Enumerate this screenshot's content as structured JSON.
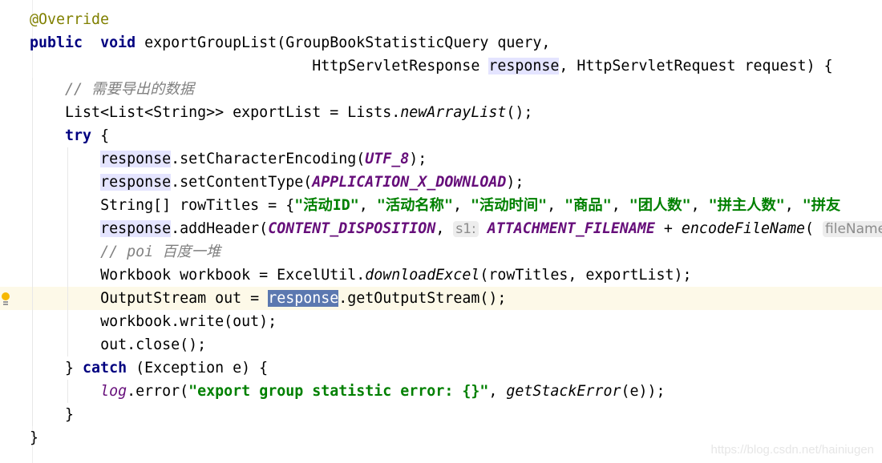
{
  "colors": {
    "keyword": "#000080",
    "annotation": "#808000",
    "comment": "#808080",
    "string": "#008000",
    "constant": "#660e7a",
    "selection": "#5b78b0",
    "reference_highlight": "#e4e4ff",
    "caret_line": "#fdf9e8"
  },
  "caret_line_index": 12,
  "gutter_icon": "intention-bulb-icon",
  "lines": [
    {
      "indent": 0,
      "tokens": [
        [
          "ann",
          "@Override"
        ]
      ]
    },
    {
      "indent": 0,
      "tokens": [
        [
          "kw",
          "public"
        ],
        [
          "",
          "  "
        ],
        [
          "kw",
          "void"
        ],
        [
          "",
          " exportGroupList(GroupBookStatisticQuery query,"
        ]
      ]
    },
    {
      "indent": 0,
      "tokens": [
        [
          "",
          "                                "
        ],
        [
          "",
          "HttpServletResponse "
        ],
        [
          "ref",
          "response"
        ],
        [
          "",
          ", HttpServletRequest request) {"
        ]
      ]
    },
    {
      "indent": 1,
      "tokens": [
        [
          "cm",
          "// 需要导出的数据"
        ]
      ]
    },
    {
      "indent": 1,
      "tokens": [
        [
          "",
          "List<List<String>> exportList = Lists."
        ],
        [
          "it",
          "newArrayList"
        ],
        [
          "",
          "();"
        ]
      ]
    },
    {
      "indent": 1,
      "tokens": [
        [
          "kw",
          "try"
        ],
        [
          "",
          " {"
        ]
      ]
    },
    {
      "indent": 2,
      "tokens": [
        [
          "ref",
          "response"
        ],
        [
          "",
          ".setCharacterEncoding("
        ],
        [
          "const",
          "UTF_8"
        ],
        [
          "",
          ");"
        ]
      ]
    },
    {
      "indent": 2,
      "tokens": [
        [
          "ref",
          "response"
        ],
        [
          "",
          ".setContentType("
        ],
        [
          "const",
          "APPLICATION_X_DOWNLOAD"
        ],
        [
          "",
          ");"
        ]
      ]
    },
    {
      "indent": 2,
      "tokens": [
        [
          "",
          "String[] rowTitles = {"
        ],
        [
          "str",
          "\"活动ID\""
        ],
        [
          "",
          ", "
        ],
        [
          "str",
          "\"活动名称\""
        ],
        [
          "",
          ", "
        ],
        [
          "str",
          "\"活动时间\""
        ],
        [
          "",
          ", "
        ],
        [
          "str",
          "\"商品\""
        ],
        [
          "",
          ", "
        ],
        [
          "str",
          "\"团人数\""
        ],
        [
          "",
          ", "
        ],
        [
          "str",
          "\"拼主人数\""
        ],
        [
          "",
          ", "
        ],
        [
          "str",
          "\"拼友"
        ]
      ]
    },
    {
      "indent": 2,
      "tokens": [
        [
          "ref",
          "response"
        ],
        [
          "",
          ".addHeader("
        ],
        [
          "const",
          "CONTENT_DISPOSITION"
        ],
        [
          "",
          ", "
        ],
        [
          "hint",
          "s1:"
        ],
        [
          "",
          " "
        ],
        [
          "const",
          "ATTACHMENT_FILENAME"
        ],
        [
          "",
          " + "
        ],
        [
          "it",
          "encodeFileName"
        ],
        [
          "",
          "( "
        ],
        [
          "hint",
          "fileName"
        ]
      ]
    },
    {
      "indent": 2,
      "tokens": [
        [
          "cm",
          "// poi 百度一堆"
        ]
      ]
    },
    {
      "indent": 2,
      "tokens": [
        [
          "",
          "Workbook workbook = ExcelUtil."
        ],
        [
          "it",
          "downloadExcel"
        ],
        [
          "",
          "(rowTitles, exportList);"
        ]
      ]
    },
    {
      "indent": 2,
      "tokens": [
        [
          "",
          "OutputStream out = "
        ],
        [
          "sel",
          "response"
        ],
        [
          "",
          ".getOutputStream();"
        ]
      ]
    },
    {
      "indent": 2,
      "tokens": [
        [
          "",
          "workbook.write(out);"
        ]
      ]
    },
    {
      "indent": 2,
      "tokens": [
        [
          "",
          "out.close();"
        ]
      ]
    },
    {
      "indent": 1,
      "tokens": [
        [
          "",
          "} "
        ],
        [
          "kw",
          "catch"
        ],
        [
          "",
          " (Exception e) {"
        ]
      ]
    },
    {
      "indent": 2,
      "tokens": [
        [
          "field",
          "log"
        ],
        [
          "",
          ".error("
        ],
        [
          "str",
          "\"export group statistic error: {}\""
        ],
        [
          "",
          ", "
        ],
        [
          "it",
          "getStackError"
        ],
        [
          "",
          "(e));"
        ]
      ]
    },
    {
      "indent": 1,
      "tokens": [
        [
          "",
          "}"
        ]
      ]
    },
    {
      "indent": 0,
      "tokens": [
        [
          "",
          "}"
        ]
      ]
    }
  ],
  "watermark": "https://blog.csdn.net/hainiugen"
}
